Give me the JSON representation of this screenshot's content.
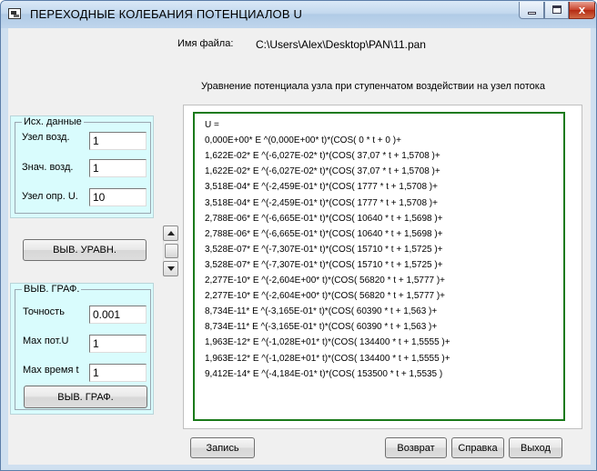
{
  "window": {
    "title": "ПЕРЕХОДНЫЕ КОЛЕБАНИЯ ПОТЕНЦИАЛОВ  U",
    "close_glyph": "x"
  },
  "file": {
    "label": "Имя файла:",
    "path": "C:\\Users\\Alex\\Desktop\\PAN\\11.pan"
  },
  "equation_header": "Уравнение  потенциала  узла  при ступенчатом воздействии на узел   потока",
  "input_group": {
    "legend": "Исх. данные",
    "fields": [
      {
        "label": "Узел  возд.",
        "value": "1"
      },
      {
        "label": "Знач. возд.",
        "value": "1"
      },
      {
        "label": "Узел опр. U.",
        "value": "10"
      }
    ]
  },
  "equation_button": "ВЫВ. УРАВН.",
  "graph_group": {
    "legend": "ВЫВ. ГРАФ.",
    "fields": [
      {
        "label": "Точность",
        "value": "0.001"
      },
      {
        "label": "Max пот.U",
        "value": "1"
      },
      {
        "label": "Max время t",
        "value": "1"
      }
    ],
    "button": "ВЫВ. ГРАФ."
  },
  "equation_lines": [
    "U =",
    "0,000E+00* E  ^(0,000E+00* t)*(COS( 0 * t + 0 )+",
    "1,622E-02* E  ^(-6,027E-02* t)*(COS( 37,07 * t + 1,5708 )+",
    "1,622E-02* E  ^(-6,027E-02* t)*(COS( 37,07 * t + 1,5708 )+",
    "3,518E-04* E  ^(-2,459E-01* t)*(COS( 1777 * t + 1,5708 )+",
    "3,518E-04* E  ^(-2,459E-01* t)*(COS( 1777 * t + 1,5708 )+",
    "2,788E-06* E  ^(-6,665E-01* t)*(COS( 10640 * t + 1,5698 )+",
    "2,788E-06* E  ^(-6,665E-01* t)*(COS( 10640 * t + 1,5698 )+",
    "3,528E-07* E  ^(-7,307E-01* t)*(COS( 15710 * t + 1,5725 )+",
    "3,528E-07* E  ^(-7,307E-01* t)*(COS( 15710 * t + 1,5725 )+",
    "2,277E-10* E  ^(-2,604E+00* t)*(COS( 56820 * t + 1,5777 )+",
    "2,277E-10* E  ^(-2,604E+00* t)*(COS( 56820 * t + 1,5777 )+",
    "8,734E-11* E  ^(-3,165E-01* t)*(COS( 60390 * t + 1,563 )+",
    "8,734E-11* E  ^(-3,165E-01* t)*(COS( 60390 * t + 1,563 )+",
    "1,963E-12* E  ^(-1,028E+01* t)*(COS( 134400 * t + 1,5555 )+",
    "1,963E-12* E  ^(-1,028E+01* t)*(COS( 134400 * t + 1,5555 )+",
    "9,412E-14* E  ^(-4,184E-01* t)*(COS( 153500 * t + 1,5535 )"
  ],
  "buttons": {
    "save": "Запись",
    "back": "Возврат",
    "help": "Справка",
    "exit": "Выход"
  },
  "colors": {
    "panel_bg": "#d9fcfd",
    "equation_border": "#1a7a1a",
    "close_button": "#c7412a"
  }
}
